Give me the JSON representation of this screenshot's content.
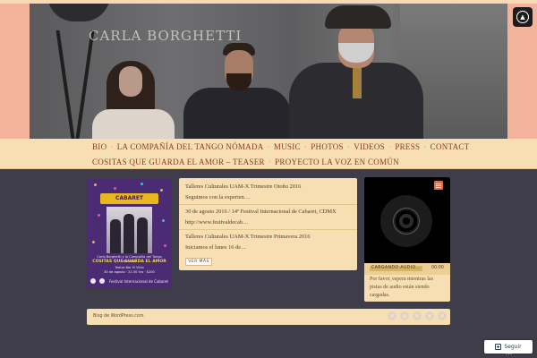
{
  "header": {
    "site_title": "CARLA BORGHETTI"
  },
  "nav": {
    "row1": [
      "BIO",
      "LA COMPAÑÍA DEL TANGO NÓMADA",
      "MUSIC",
      "PHOTOS",
      "VIDEOS",
      "PRESS",
      "CONTACT"
    ],
    "row2": [
      "COSITAS QUE GUARDA EL AMOR – TEASER",
      "PROYECTO LA VOZ EN COMÚN"
    ]
  },
  "promo": {
    "badge": "CABARET",
    "line1": "Carla Borghetti y la Compañía del Tango Nómada",
    "line2": "COSITAS QUE GUARDA EL AMOR",
    "line3": "Teatro Bar El Vicio",
    "line4": "30 de agosto · 21:30 hrs · $200",
    "sponsor": "Festival Internacional de Cabaret"
  },
  "posts": {
    "items": [
      {
        "title": "Talleres Culturales UAM-X Trimestre Otoño 2016",
        "excerpt": "Seguimos con la experien…"
      },
      {
        "title": "30 de agosto 2016 / 14º Festival Internacional de Cabaret, CDMX",
        "excerpt": "http://www.festivaldecab…"
      },
      {
        "title": "Talleres Culturales UAM-X Trimestre Primavera 2016",
        "excerpt": "Iniciamos el lunes 16 de…"
      }
    ],
    "more_label": "VER MÁS"
  },
  "player": {
    "loading_label": "CARGANDO AUDIO…",
    "time": "00:00",
    "message": "Por favor, espera mientras las pistas de audio están siendo cargadas."
  },
  "footer": {
    "credit": "Blog de WordPress.com."
  },
  "follow": {
    "label": "Seguir"
  }
}
